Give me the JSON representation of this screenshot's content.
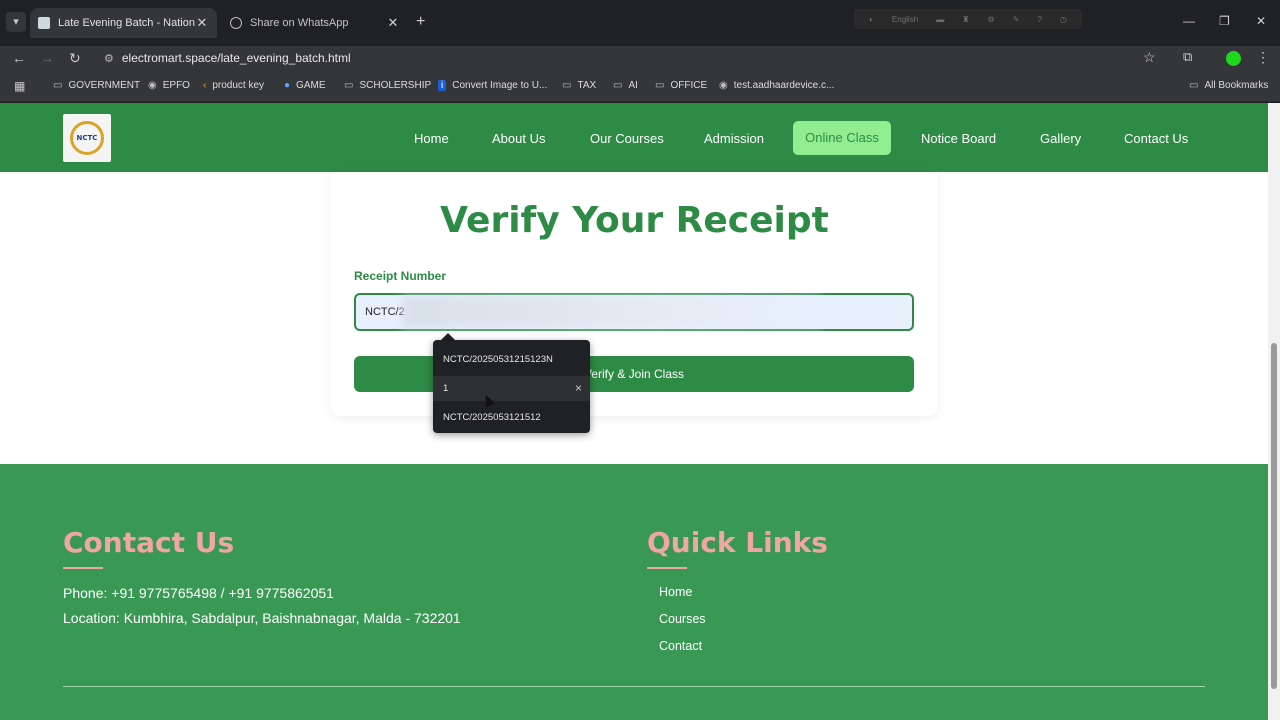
{
  "browser": {
    "tabs": [
      {
        "title": "Late Evening Batch - National C",
        "active": true
      },
      {
        "title": "Share on WhatsApp",
        "active": false
      }
    ],
    "url": "electromart.space/late_evening_batch.html",
    "extension_language": "English",
    "bookmarks": [
      {
        "label": "GOVERNMENT",
        "icon": "folder-icon"
      },
      {
        "label": "EPFO",
        "icon": "globe-icon"
      },
      {
        "label": "product key",
        "icon": "arrow-icon"
      },
      {
        "label": "GAME",
        "icon": "globe-icon"
      },
      {
        "label": "SCHOLERSHIP",
        "icon": "folder-icon"
      },
      {
        "label": "Convert Image to U...",
        "icon": "info-icon"
      },
      {
        "label": "TAX",
        "icon": "folder-icon"
      },
      {
        "label": "AI",
        "icon": "folder-icon"
      },
      {
        "label": "OFFICE",
        "icon": "folder-icon"
      },
      {
        "label": "test.aadhaardevice.c...",
        "icon": "globe-icon"
      }
    ],
    "all_bookmarks": "All Bookmarks"
  },
  "site": {
    "logo_text": "NCTC",
    "nav": [
      {
        "label": "Home"
      },
      {
        "label": "About Us"
      },
      {
        "label": "Our Courses"
      },
      {
        "label": "Admission"
      },
      {
        "label": "Online Class",
        "active": true
      },
      {
        "label": "Notice Board"
      },
      {
        "label": "Gallery"
      },
      {
        "label": "Contact Us"
      }
    ]
  },
  "verify": {
    "title": "Verify Your Receipt",
    "field_label": "Receipt Number",
    "input_value": "NCTC/2",
    "button_label": "Verify & Join Class"
  },
  "autocomplete": {
    "items": [
      {
        "value": "NCTC/20250531215123N"
      },
      {
        "value": "1",
        "hovered": true,
        "remove_icon": "×"
      },
      {
        "value": "NCTC/2025053121512"
      }
    ]
  },
  "footer": {
    "contact_heading": "Contact Us",
    "phone": "Phone: +91 9775765498 / +91 9775862051",
    "location": "Location: Kumbhira, Sabdalpur, Baishnabnagar, Malda - 732201",
    "links_heading": "Quick Links",
    "links": [
      "Home",
      "Courses",
      "Contact"
    ]
  },
  "colors": {
    "brand_green": "#2e8b45",
    "footer_green": "#399954",
    "active_nav_bg": "#90ee90",
    "heading_pink": "#f2a5a5"
  }
}
